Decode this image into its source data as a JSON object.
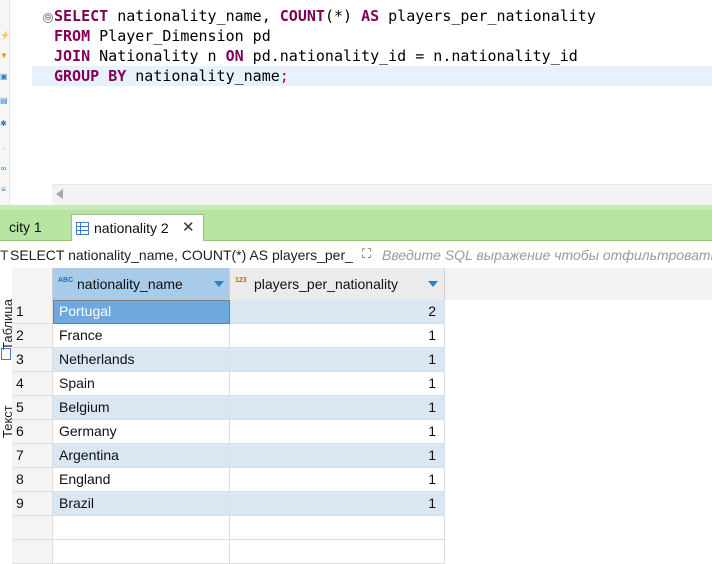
{
  "editor": {
    "lines": [
      [
        {
          "t": "SELECT",
          "k": true
        },
        {
          "t": " nationality_name, "
        },
        {
          "t": "COUNT",
          "k": true
        },
        {
          "t": "(*) "
        },
        {
          "t": "AS",
          "k": true
        },
        {
          "t": " players_per_nationality"
        }
      ],
      [
        {
          "t": "FROM",
          "k": true
        },
        {
          "t": " Player_Dimension pd"
        }
      ],
      [
        {
          "t": "JOIN",
          "k": true
        },
        {
          "t": " Nationality n "
        },
        {
          "t": "ON",
          "k": true
        },
        {
          "t": " pd.nationality_id = n.nationality_id"
        }
      ],
      [
        {
          "t": "GROUP",
          "k": true
        },
        {
          "t": " "
        },
        {
          "t": "BY",
          "k": true
        },
        {
          "t": " nationality_name"
        },
        {
          "t": ";",
          "s": true
        }
      ]
    ],
    "fold_symbol": "⊖"
  },
  "tabs": [
    {
      "label": "city 1",
      "active": false
    },
    {
      "label": "nationality 2",
      "active": true,
      "close": "✕"
    }
  ],
  "filter": {
    "prefix": "T",
    "query": "SELECT nationality_name, COUNT(*) AS players_per_",
    "placeholder": "Введите SQL выражение чтобы отфильтровать"
  },
  "side_tabs": {
    "table": "Таблица",
    "text": "Текст"
  },
  "columns": [
    {
      "name": "nationality_name",
      "type_icon": "ABC"
    },
    {
      "name": "players_per_nationality",
      "type_icon": "123"
    }
  ],
  "rows": [
    {
      "num": "1",
      "name": "Portugal",
      "count": "2"
    },
    {
      "num": "2",
      "name": "France",
      "count": "1"
    },
    {
      "num": "3",
      "name": "Netherlands",
      "count": "1"
    },
    {
      "num": "4",
      "name": "Spain",
      "count": "1"
    },
    {
      "num": "5",
      "name": "Belgium",
      "count": "1"
    },
    {
      "num": "6",
      "name": "Germany",
      "count": "1"
    },
    {
      "num": "7",
      "name": "Argentina",
      "count": "1"
    },
    {
      "num": "8",
      "name": "England",
      "count": "1"
    },
    {
      "num": "9",
      "name": "Brazil",
      "count": "1"
    }
  ],
  "colors": {
    "keyword": "#7f0055",
    "tab_bar": "#b7e4a0",
    "selection": "#6fa8dc",
    "alt_row": "#dbe6f3"
  }
}
